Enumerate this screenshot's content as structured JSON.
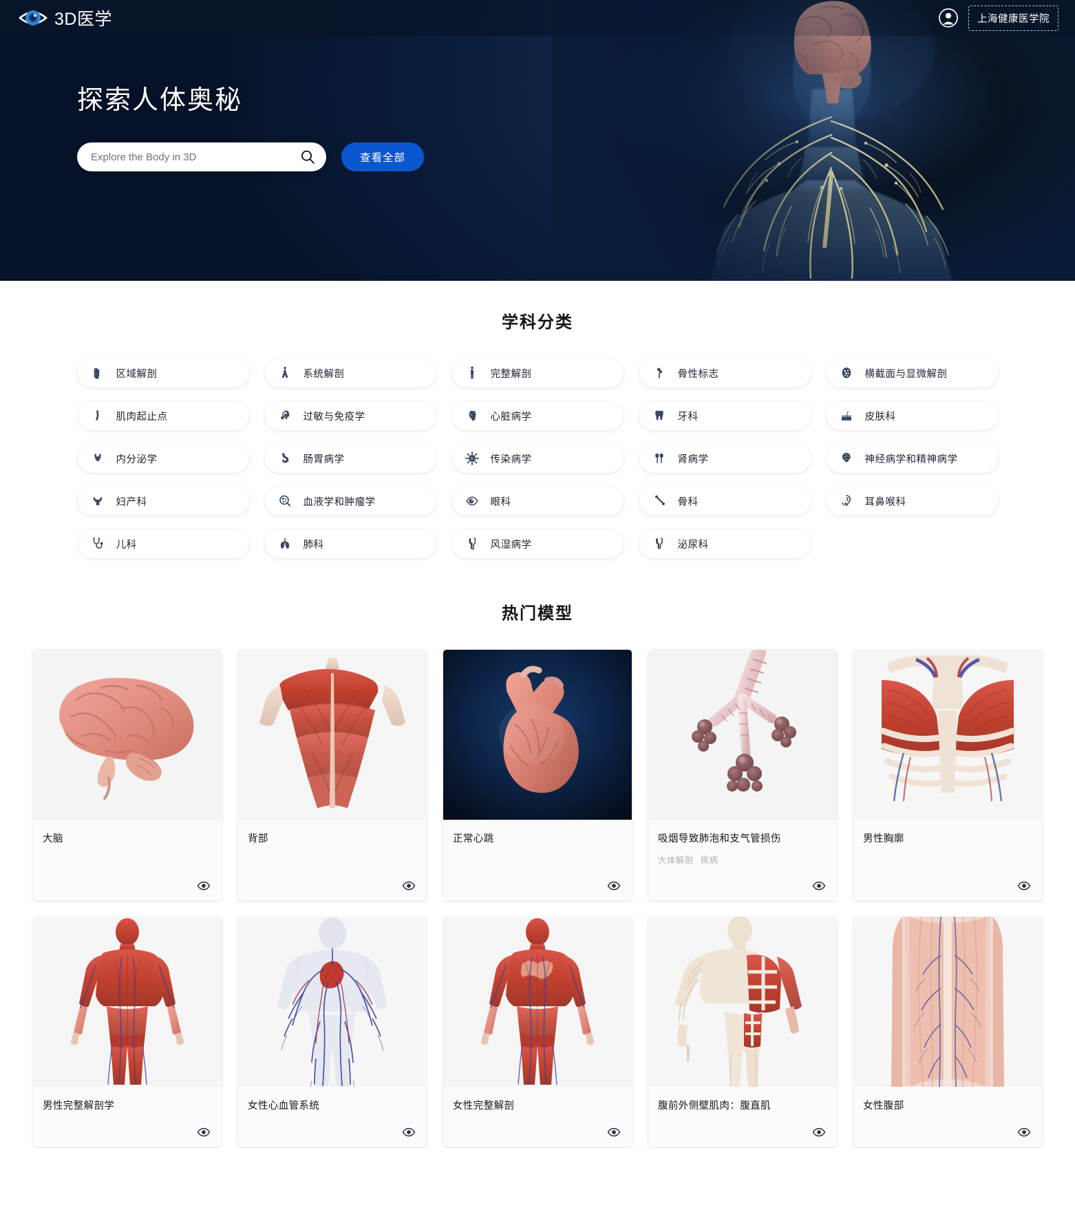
{
  "header": {
    "brand": "3D医学",
    "brand_icon": "eye-logo-icon",
    "user_icon": "user-circle-icon",
    "org_label": "上海健康医学院"
  },
  "hero": {
    "title": "探索人体奥秘",
    "search_placeholder": "Explore the Body in 3D",
    "search_value": "",
    "search_icon": "search-icon",
    "view_all_label": "查看全部",
    "accent_color": "#0b57d0",
    "background_color": "#0a1b38"
  },
  "categories": {
    "title": "学科分类",
    "items": [
      {
        "label": "区域解剖",
        "icon": "head-profile-icon"
      },
      {
        "label": "系统解剖",
        "icon": "lungs-body-icon"
      },
      {
        "label": "完整解剖",
        "icon": "full-body-icon"
      },
      {
        "label": "骨性标志",
        "icon": "bone-landmark-icon"
      },
      {
        "label": "横截面与显微解剖",
        "icon": "cross-section-icon"
      },
      {
        "label": "肌肉起止点",
        "icon": "muscle-attachment-icon"
      },
      {
        "label": "过敏与免疫学",
        "icon": "allergy-immunology-icon"
      },
      {
        "label": "心脏病学",
        "icon": "heart-icon"
      },
      {
        "label": "牙科",
        "icon": "tooth-icon"
      },
      {
        "label": "皮肤科",
        "icon": "skin-hair-icon"
      },
      {
        "label": "内分泌学",
        "icon": "thyroid-icon"
      },
      {
        "label": "肠胃病学",
        "icon": "stomach-icon"
      },
      {
        "label": "传染病学",
        "icon": "virus-icon"
      },
      {
        "label": "肾病学",
        "icon": "kidneys-icon"
      },
      {
        "label": "神经病学和精神病学",
        "icon": "brain-icon"
      },
      {
        "label": "妇产科",
        "icon": "uterus-icon"
      },
      {
        "label": "血液学和肿瘤学",
        "icon": "blood-cell-icon"
      },
      {
        "label": "眼科",
        "icon": "eye-icon"
      },
      {
        "label": "骨科",
        "icon": "bone-joint-icon"
      },
      {
        "label": "耳鼻喉科",
        "icon": "ear-icon"
      },
      {
        "label": "儿科",
        "icon": "stethoscope-icon"
      },
      {
        "label": "肺科",
        "icon": "lungs-icon"
      },
      {
        "label": "风湿病学",
        "icon": "joint-bones-icon"
      },
      {
        "label": "泌尿科",
        "icon": "bladder-icon"
      }
    ]
  },
  "models": {
    "title": "热门模型",
    "view_icon": "eye-view-icon",
    "items": [
      {
        "name": "大脑",
        "tags": [],
        "thumb": "brain-lateral",
        "thumb_dark": false
      },
      {
        "name": "背部",
        "tags": [],
        "thumb": "back-muscles",
        "thumb_dark": false
      },
      {
        "name": "正常心跳",
        "tags": [],
        "thumb": "beating-heart",
        "thumb_dark": true
      },
      {
        "name": "吸烟导致肺泡和支气管损伤",
        "tags": [
          "大体解剖",
          "疾病"
        ],
        "thumb": "alveoli-damage",
        "thumb_dark": false
      },
      {
        "name": "男性胸廓",
        "tags": [],
        "thumb": "male-thorax",
        "thumb_dark": false
      },
      {
        "name": "男性完整解剖学",
        "tags": [],
        "thumb": "male-full-anatomy",
        "thumb_dark": false
      },
      {
        "name": "女性心血管系统",
        "tags": [],
        "thumb": "female-cardiovascular",
        "thumb_dark": false
      },
      {
        "name": "女性完整解剖",
        "tags": [],
        "thumb": "female-full-anatomy",
        "thumb_dark": false
      },
      {
        "name": "腹前外侧壁肌肉：腹直肌",
        "tags": [],
        "thumb": "rectus-abdominis",
        "thumb_dark": false
      },
      {
        "name": "女性腹部",
        "tags": [],
        "thumb": "female-abdomen",
        "thumb_dark": false
      }
    ]
  }
}
